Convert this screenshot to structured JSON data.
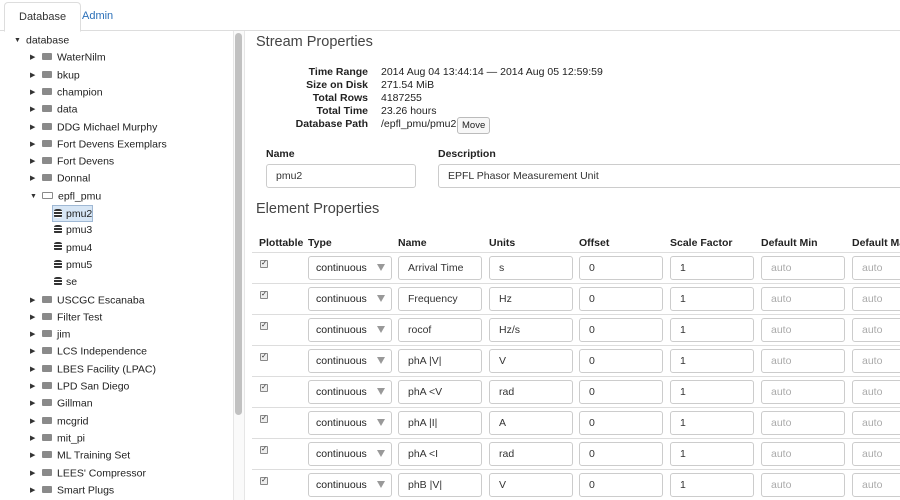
{
  "tabs": [
    {
      "label": "Database",
      "active": true
    },
    {
      "label": "Admin",
      "active": false
    }
  ],
  "tree": {
    "root": "database",
    "items": [
      {
        "label": "WaterNilm",
        "kind": "folder"
      },
      {
        "label": "bkup",
        "kind": "folder"
      },
      {
        "label": "champion",
        "kind": "folder"
      },
      {
        "label": "data",
        "kind": "folder"
      },
      {
        "label": "DDG Michael Murphy",
        "kind": "folder"
      },
      {
        "label": "Fort Devens Exemplars",
        "kind": "folder"
      },
      {
        "label": "Fort Devens",
        "kind": "folder"
      },
      {
        "label": "Donnal",
        "kind": "folder"
      },
      {
        "label": "epfl_pmu",
        "kind": "folder-open"
      },
      {
        "label": "pmu2",
        "kind": "stream",
        "selected": true
      },
      {
        "label": "pmu3",
        "kind": "stream"
      },
      {
        "label": "pmu4",
        "kind": "stream"
      },
      {
        "label": "pmu5",
        "kind": "stream"
      },
      {
        "label": "se",
        "kind": "stream"
      },
      {
        "label": "USCGC Escanaba",
        "kind": "folder"
      },
      {
        "label": "Filter Test",
        "kind": "folder"
      },
      {
        "label": "jim",
        "kind": "folder"
      },
      {
        "label": "LCS Independence",
        "kind": "folder"
      },
      {
        "label": "LBES Facility (LPAC)",
        "kind": "folder"
      },
      {
        "label": "LPD San Diego",
        "kind": "folder"
      },
      {
        "label": "Gillman",
        "kind": "folder"
      },
      {
        "label": "mcgrid",
        "kind": "folder"
      },
      {
        "label": "mit_pi",
        "kind": "folder"
      },
      {
        "label": "ML Training Set",
        "kind": "folder"
      },
      {
        "label": "LEES' Compressor",
        "kind": "folder"
      },
      {
        "label": "Smart Plugs",
        "kind": "folder"
      }
    ]
  },
  "stream": {
    "heading": "Stream Properties",
    "fields": [
      {
        "key": "Time Range",
        "value": "2014 Aug 04 13:44:14 — 2014 Aug 05 12:59:59"
      },
      {
        "key": "Size on Disk",
        "value": "271.54 MiB"
      },
      {
        "key": "Total Rows",
        "value": "4187255"
      },
      {
        "key": "Total Time",
        "value": "23.26 hours"
      },
      {
        "key": "Database Path",
        "value": "/epfl_pmu/pmu2"
      }
    ],
    "move_label": "Move",
    "name_label": "Name",
    "name_value": "pmu2",
    "description_label": "Description",
    "description_value": "EPFL Phasor Measurement Unit"
  },
  "elements": {
    "heading": "Element Properties",
    "columns": [
      "Plottable",
      "Type",
      "Name",
      "Units",
      "Offset",
      "Scale Factor",
      "Default Min",
      "Default Max"
    ],
    "rows": [
      {
        "plottable": true,
        "type": "continuous",
        "name": "Arrival Time",
        "units": "s",
        "offset": "0",
        "scale": "1",
        "min": "auto",
        "max": "auto"
      },
      {
        "plottable": true,
        "type": "continuous",
        "name": "Frequency",
        "units": "Hz",
        "offset": "0",
        "scale": "1",
        "min": "auto",
        "max": "auto"
      },
      {
        "plottable": true,
        "type": "continuous",
        "name": "rocof",
        "units": "Hz/s",
        "offset": "0",
        "scale": "1",
        "min": "auto",
        "max": "auto"
      },
      {
        "plottable": true,
        "type": "continuous",
        "name": "phA |V|",
        "units": "V",
        "offset": "0",
        "scale": "1",
        "min": "auto",
        "max": "auto"
      },
      {
        "plottable": true,
        "type": "continuous",
        "name": "phA <V",
        "units": "rad",
        "offset": "0",
        "scale": "1",
        "min": "auto",
        "max": "auto"
      },
      {
        "plottable": true,
        "type": "continuous",
        "name": "phA |I|",
        "units": "A",
        "offset": "0",
        "scale": "1",
        "min": "auto",
        "max": "auto"
      },
      {
        "plottable": true,
        "type": "continuous",
        "name": "phA <I",
        "units": "rad",
        "offset": "0",
        "scale": "1",
        "min": "auto",
        "max": "auto"
      },
      {
        "plottable": true,
        "type": "continuous",
        "name": "phB |V|",
        "units": "V",
        "offset": "0",
        "scale": "1",
        "min": "auto",
        "max": "auto"
      }
    ]
  }
}
